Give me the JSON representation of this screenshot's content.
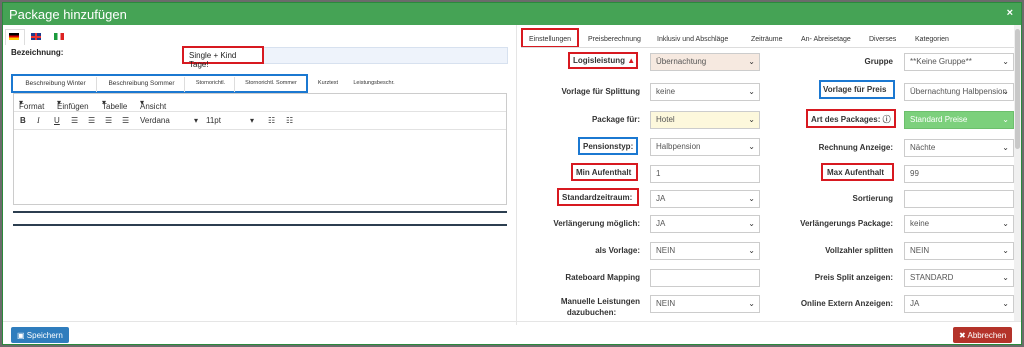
{
  "modal": {
    "title": "Package hinzufügen",
    "close": "×"
  },
  "left": {
    "flags": [
      "de",
      "gb",
      "it"
    ],
    "bezeichnung_label": "Bezeichnung:",
    "bezeichnung_value": "Single + Kind Tage!",
    "desc_tabs": [
      "Beschreibung Winter",
      "Beschreibung Sommer",
      "Stornorichtl.",
      "Stornorichtl. Sommer",
      "Kurztext",
      "Leistungsbeschr."
    ],
    "menu": [
      "Format",
      "Einfügen",
      "Tabelle",
      "Ansicht"
    ],
    "toolbar": {
      "font": "Verdana",
      "size": "11pt"
    }
  },
  "tabs": [
    "Einstellungen",
    "Preisberechnung",
    "Inklusiv und Abschläge",
    "Zeiträume",
    "An- Abreisetage",
    "Diverses",
    "Kategorien"
  ],
  "fields": {
    "logisleistung": {
      "label": "Logisleistung",
      "value": "Übernachtung"
    },
    "gruppe": {
      "label": "Gruppe",
      "value": "**Keine Gruppe**"
    },
    "vorlage_splittung": {
      "label": "Vorlage für Splittung",
      "value": "keine"
    },
    "vorlage_preis": {
      "label": "Vorlage für Preis",
      "value": "Übernachtung Halbpension"
    },
    "package_fuer": {
      "label": "Package für:",
      "value": "Hotel"
    },
    "art_packages": {
      "label": "Art des Packages:",
      "value": "Standard Preise"
    },
    "pensionstyp": {
      "label": "Pensionstyp:",
      "value": "Halbpension"
    },
    "rechnung_anzeige": {
      "label": "Rechnung Anzeige:",
      "value": "Nächte"
    },
    "min_aufenthalt": {
      "label": "Min Aufenthalt",
      "value": "1"
    },
    "max_aufenthalt": {
      "label": "Max Aufenthalt",
      "value": "99"
    },
    "standardzeitraum": {
      "label": "Standardzeitraum:",
      "value": "JA"
    },
    "sortierung": {
      "label": "Sortierung",
      "value": ""
    },
    "verlaengerung": {
      "label": "Verlängerung möglich:",
      "value": "JA"
    },
    "verlaengerungs_package": {
      "label": "Verlängerungs Package:",
      "value": "keine"
    },
    "als_vorlage": {
      "label": "als Vorlage:",
      "value": "NEIN"
    },
    "vollzahler": {
      "label": "Vollzahler splitten",
      "value": "NEIN"
    },
    "rateboard": {
      "label": "Rateboard Mapping",
      "value": ""
    },
    "preis_split": {
      "label": "Preis Split anzeigen:",
      "value": "STANDARD"
    },
    "manuelle_1": {
      "label": "Manuelle Leistungen",
      "value": "NEIN"
    },
    "manuelle_2": {
      "label": "dazubuchen:"
    },
    "online_extern": {
      "label": "Online Extern Anzeigen:",
      "value": "JA"
    }
  },
  "footer": {
    "save": "Speichern",
    "cancel": "Abbrechen"
  },
  "colors": {
    "header": "#45a355",
    "save": "#2f7dbd",
    "cancel": "#b4332a",
    "annot_red": "#d71920",
    "annot_blue": "#1b78d1"
  }
}
